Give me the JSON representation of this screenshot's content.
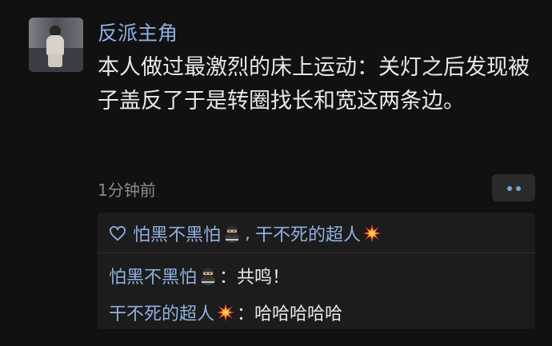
{
  "comment": {
    "author": "反派主角",
    "text": "本人做过最激烈的床上运动：关灯之后发现被子盖反了于是转圈找长和宽这两条边。",
    "time": "1分钟前",
    "more_icon": "more-dots-icon"
  },
  "likes": {
    "icon": "heart-outline-icon",
    "users": [
      {
        "name": "怕黑不黑怕",
        "emoji": "ninja-emoji"
      },
      {
        "name": "干不死的超人",
        "emoji": "collision-emoji"
      }
    ],
    "separator": ","
  },
  "replies": [
    {
      "name": "怕黑不黑怕",
      "emoji": "ninja-emoji",
      "separator": "：",
      "text": "共鸣！"
    },
    {
      "name": "干不死的超人",
      "emoji": "collision-emoji",
      "separator": "：",
      "text": "哈哈哈哈哈"
    }
  ],
  "colors": {
    "background": "#111111",
    "name_link": "#8fb0e0",
    "body_text": "#e8e8e8",
    "muted_text": "#8a8a8a",
    "reply_box": "#1c1c1c"
  }
}
